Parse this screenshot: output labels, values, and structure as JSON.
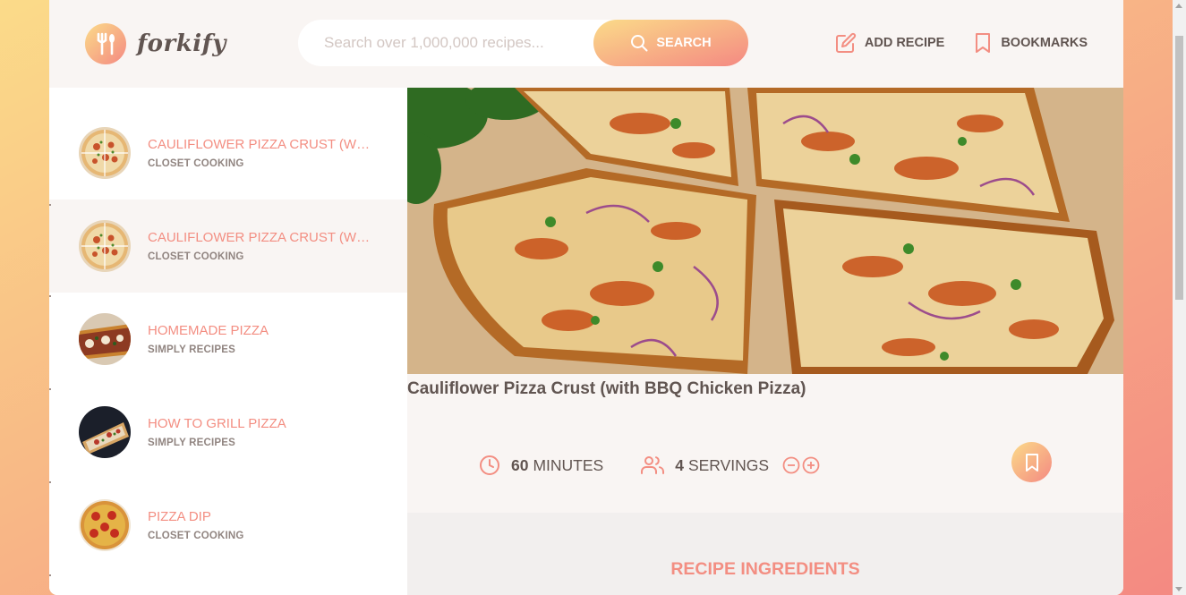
{
  "header": {
    "logo_text": "forkify",
    "search": {
      "placeholder": "Search over 1,000,000 recipes...",
      "button_label": "SEARCH"
    },
    "nav": {
      "add_recipe_label": "ADD RECIPE",
      "bookmarks_label": "BOOKMARKS"
    }
  },
  "results": [
    {
      "title": "CAULIFLOWER PIZZA CRUST (WIT...",
      "publisher": "CLOSET COOKING",
      "active": false
    },
    {
      "title": "CAULIFLOWER PIZZA CRUST (WIT...",
      "publisher": "CLOSET COOKING",
      "active": true
    },
    {
      "title": "HOMEMADE PIZZA",
      "publisher": "SIMPLY RECIPES",
      "active": false
    },
    {
      "title": "HOW TO GRILL PIZZA",
      "publisher": "SIMPLY RECIPES",
      "active": false
    },
    {
      "title": "PIZZA DIP",
      "publisher": "CLOSET COOKING",
      "active": false
    }
  ],
  "recipe": {
    "title": "Cauliflower Pizza Crust (with BBQ Chicken Pizza)",
    "cooking_time": "60",
    "cooking_time_unit": "MINUTES",
    "servings": "4",
    "servings_unit": "SERVINGS",
    "ingredients_heading": "RECIPE INGREDIENTS"
  },
  "colors": {
    "accent": "#f38e82",
    "gradient_start": "#fbdb89",
    "gradient_end": "#f48982",
    "text": "#615551",
    "panel_bg": "#f9f5f3"
  }
}
